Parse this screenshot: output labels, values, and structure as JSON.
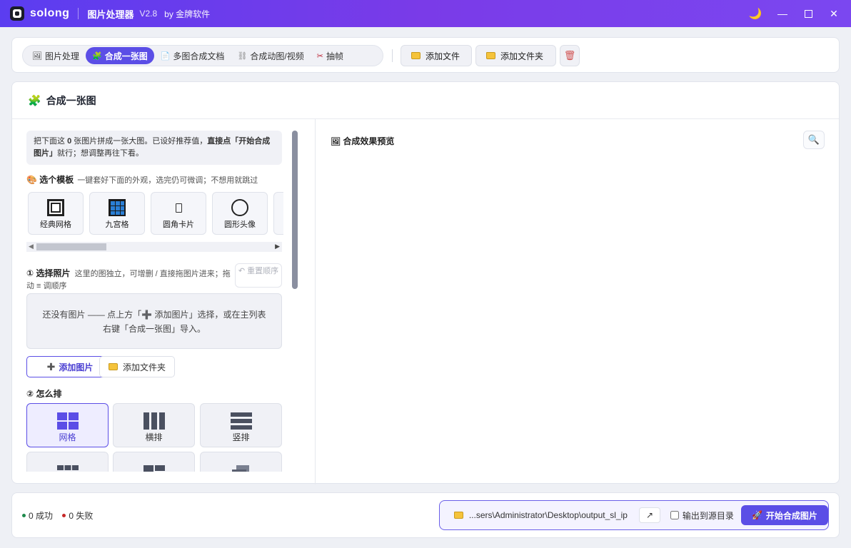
{
  "titlebar": {
    "brand": "solong",
    "app_title": "图片处理器",
    "version": "V2.8",
    "by": "by 金牌软件"
  },
  "tabs": [
    {
      "label": "图片处理"
    },
    {
      "label": "合成一张图"
    },
    {
      "label": "多图合成文档"
    },
    {
      "label": "合成动图/视频"
    },
    {
      "label": "抽帧"
    }
  ],
  "toolbar": {
    "add_file": "添加文件",
    "add_folder": "添加文件夹"
  },
  "panel": {
    "title": "合成一张图"
  },
  "hint": {
    "p1": "把下面这 ",
    "count": "0",
    "p2": " 张图片拼成一张大图。已设好推荐值，",
    "bold": "直接点「开始合成图片」",
    "p3": "就行；想调整再往下看。"
  },
  "templates": {
    "title": "选个模板",
    "subtitle": "一键套好下面的外观，选完仍可微调；不想用就跳过",
    "items": [
      {
        "label": "经典网格"
      },
      {
        "label": "九宫格"
      },
      {
        "label": "圆角卡片"
      },
      {
        "label": "圆形头像"
      }
    ]
  },
  "step1": {
    "title": "① 选择照片",
    "desc": "这里的图独立，可增删 / 直接拖图片进来；拖动 ≡ 调顺序",
    "reorder": "↶ 重置顺序"
  },
  "empty": {
    "text": "还没有图片 —— 点上方「➕ 添加图片」选择，或在主列表右键「合成一张图」导入。"
  },
  "buttons": {
    "add_image": "添加图片",
    "add_folder": "添加文件夹"
  },
  "step2": {
    "title": "② 怎么排",
    "layouts": [
      {
        "label": "网格"
      },
      {
        "label": "横排"
      },
      {
        "label": "竖排"
      }
    ]
  },
  "preview": {
    "title": "合成效果预览"
  },
  "footer": {
    "success": "0 成功",
    "fail": "0 失败",
    "path": "...sers\\Administrator\\Desktop\\output_sl_ip",
    "output_to_source": "输出到源目录",
    "start": "开始合成图片"
  },
  "colors": {
    "accent": "#5b4ee6",
    "success": "#1e8a4c",
    "fail": "#c62828"
  }
}
